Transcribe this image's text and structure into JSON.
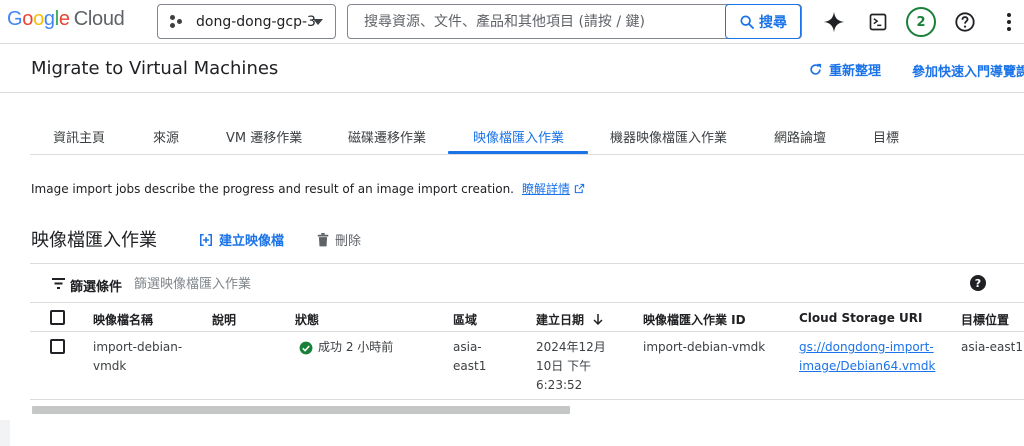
{
  "brand": {
    "logo_letters": [
      "G",
      "o",
      "o",
      "g",
      "l",
      "e"
    ],
    "logo_product": "Cloud",
    "colors": {
      "blue": "#4285f4",
      "red": "#ea4335",
      "yellow": "#fbbc04",
      "green": "#34a853"
    }
  },
  "topbar": {
    "project_name": "dong-dong-gcp-3",
    "search_placeholder": "搜尋資源、文件、產品和其他項目 (請按 / 鍵)",
    "search_button": "搜尋",
    "notification_count": "2",
    "icons": [
      "sparkle-icon",
      "terminal-icon",
      "help-circle-icon",
      "more-vert-icon"
    ]
  },
  "header": {
    "title": "Migrate to Virtual Machines",
    "refresh": "重新整理",
    "quickstart": "參加快速入門導覽課"
  },
  "tabs": [
    {
      "label": "資訊主頁",
      "active": false
    },
    {
      "label": "來源",
      "active": false
    },
    {
      "label": "VM 遷移作業",
      "active": false
    },
    {
      "label": "磁碟遷移作業",
      "active": false
    },
    {
      "label": "映像檔匯入作業",
      "active": true
    },
    {
      "label": "機器映像檔匯入作業",
      "active": false
    },
    {
      "label": "網路論壇",
      "active": false
    },
    {
      "label": "目標",
      "active": false
    }
  ],
  "description": {
    "text": "Image import jobs describe the progress and result of an image import creation.",
    "link": "瞭解詳情"
  },
  "section": {
    "title": "映像檔匯入作業",
    "create_button": "建立映像檔",
    "delete_button": "刪除"
  },
  "filter": {
    "label": "篩選條件",
    "placeholder": "篩選映像檔匯入作業"
  },
  "table": {
    "columns": [
      "映像檔名稱",
      "說明",
      "狀態",
      "區域",
      "建立日期",
      "映像檔匯入作業 ID",
      "Cloud Storage URI",
      "目標位置"
    ],
    "sort_column": "建立日期",
    "rows": [
      {
        "name": [
          "import-debian-",
          "vmdk"
        ],
        "description": "",
        "status": "成功 2 小時前",
        "region": [
          "asia-",
          "east1"
        ],
        "created": [
          "2024年12月",
          "10日 下午",
          "6:23:52"
        ],
        "job_id": "import-debian-vmdk",
        "uri": [
          "gs://dongdong-import-",
          "image/Debian64.vmdk"
        ],
        "target": "asia-east1"
      }
    ]
  },
  "accent_color": "#1a73e8",
  "success_color": "#188038"
}
